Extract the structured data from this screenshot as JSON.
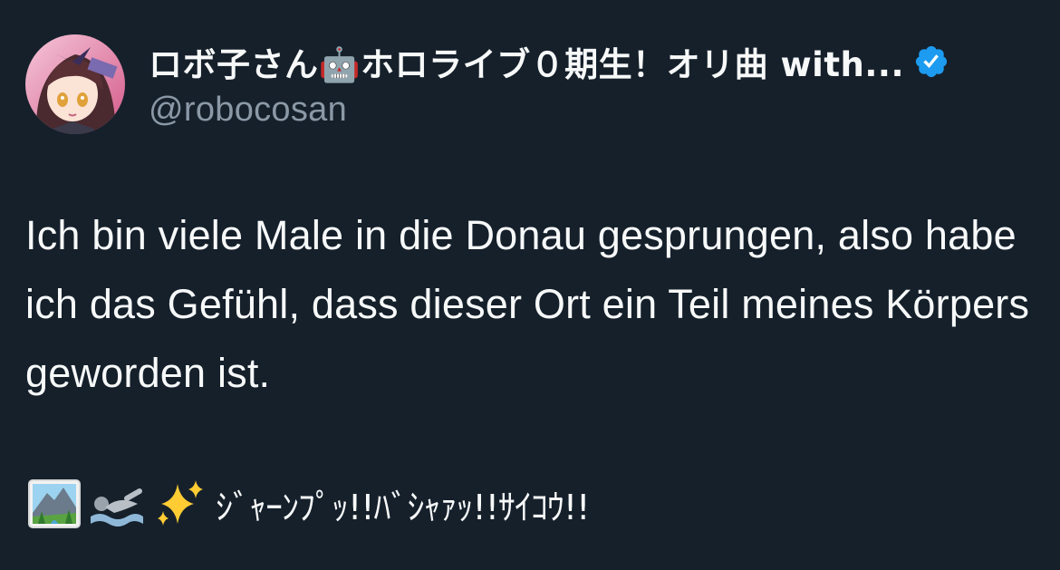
{
  "tweet": {
    "display_name": "ロボ子さん🤖ホロライブ０期生！オリ曲 with...",
    "handle": "@robocosan",
    "verified": true,
    "body": "Ich bin viele Male in die Donau gesprungen, also habe ich das Gefühl, dass dieser Ort ein Teil meines Körpers geworden ist.",
    "emoji_icons": [
      "national-park-emoji",
      "swimmer-emoji",
      "sparkles-emoji"
    ],
    "emoji_text": "ｼﾞｬｰﾝﾌﾟｯ!!ﾊﾞｼｬｧｯ!!ｻｲｺｳ!!"
  },
  "colors": {
    "background": "#15202b",
    "text_primary": "#f7f9f9",
    "text_secondary": "#8b98a5",
    "verified_badge": "#1d9bf0"
  }
}
